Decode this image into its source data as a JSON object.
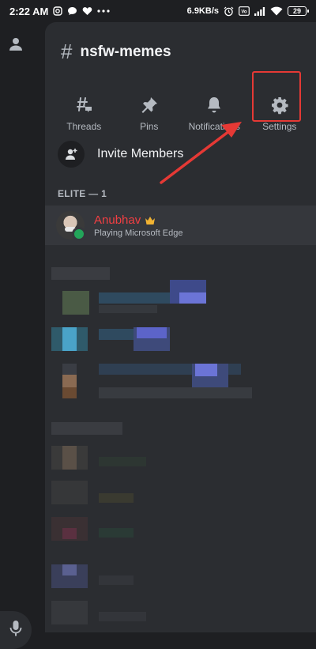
{
  "status_bar": {
    "time": "2:22 AM",
    "left_icons": [
      "instagram-icon",
      "chat-bubble-icon",
      "heart-icon",
      "more-dots-icon"
    ],
    "speed": "6.9KB/s",
    "right_icons": [
      "alarm-icon",
      "volte-icon",
      "signal-icon",
      "wifi-icon"
    ],
    "battery": "29"
  },
  "channel": {
    "hash": "#",
    "name": "nsfw-memes"
  },
  "actions": [
    {
      "label": "Threads",
      "icon": "threads-icon"
    },
    {
      "label": "Pins",
      "icon": "pin-icon"
    },
    {
      "label": "Notifications",
      "icon": "bell-icon"
    },
    {
      "label": "Settings",
      "icon": "gear-icon"
    }
  ],
  "invite": {
    "label": "Invite Members",
    "icon": "add-user-icon"
  },
  "members_section": {
    "title": "ELITE — 1",
    "member": {
      "name": "Anubhav",
      "activity": "Playing Microsoft Edge",
      "badge": "crown-icon",
      "status": "online"
    }
  },
  "colors": {
    "background": "#1e1f22",
    "panel": "#2b2d31",
    "member_name": "#f23f43",
    "online": "#23a55a",
    "annotation": "#e53935",
    "crown": "#f0b232"
  }
}
